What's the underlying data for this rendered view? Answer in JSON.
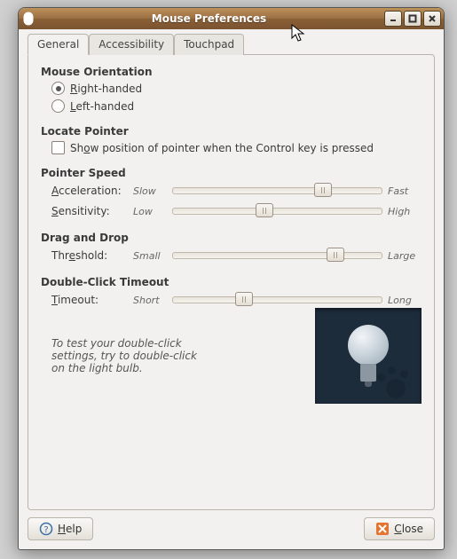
{
  "window": {
    "title": "Mouse Preferences"
  },
  "tabs": {
    "general": "General",
    "accessibility": "Accessibility",
    "touchpad": "Touchpad",
    "active": "general"
  },
  "orientation": {
    "title": "Mouse Orientation",
    "right": "ight-handed",
    "right_accel": "R",
    "left": "eft-handed",
    "left_accel": "L",
    "value": "right"
  },
  "locate": {
    "title": "Locate Pointer",
    "label_before": "Sh",
    "label_accel": "o",
    "label_after": "w position of pointer when the Control key is pressed",
    "checked": false
  },
  "pointer": {
    "title": "Pointer Speed",
    "accel_label_pre": "",
    "accel_accel": "A",
    "accel_label_post": "cceleration:",
    "accel_low": "Slow",
    "accel_high": "Fast",
    "accel_value_pct": 72,
    "sens_label_pre": "",
    "sens_accel": "S",
    "sens_label_post": "ensitivity:",
    "sens_low": "Low",
    "sens_high": "High",
    "sens_value_pct": 44
  },
  "dragdrop": {
    "title": "Drag and Drop",
    "label_pre": "Thr",
    "label_accel": "e",
    "label_post": "shold:",
    "low": "Small",
    "high": "Large",
    "value_pct": 78
  },
  "dbl": {
    "title": "Double-Click Timeout",
    "label_pre": "",
    "label_accel": "T",
    "label_post": "imeout:",
    "low": "Short",
    "high": "Long",
    "value_pct": 34,
    "hint": "To test your double-click settings, try to double-click on the light bulb."
  },
  "buttons": {
    "help_accel": "H",
    "help_rest": "elp",
    "close_accel": "C",
    "close_rest": "lose"
  }
}
